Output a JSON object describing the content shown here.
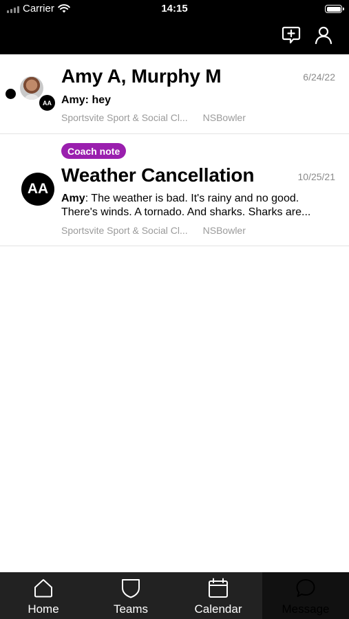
{
  "status_bar": {
    "carrier": "Carrier",
    "time": "14:15"
  },
  "header": {
    "icons": [
      "new-message-icon",
      "profile-icon"
    ]
  },
  "conversations": [
    {
      "title": "Amy A, Murphy M",
      "date": "6/24/22",
      "preview_sender": "Amy:",
      "preview_text": " hey",
      "team": "Sportsvite Sport & Social Cl...",
      "author": "NSBowler",
      "avatar_initials": "AA",
      "unread": true
    },
    {
      "badge": "Coach note",
      "title": "Weather Cancellation",
      "date": "10/25/21",
      "preview_sender": "Amy",
      "preview_text": ": The weather is bad. It's rainy and no good. There's winds. A tornado. And sharks. Sharks are...",
      "team": "Sportsvite Sport & Social Cl...",
      "author": "NSBowler",
      "avatar_initials": "AA"
    }
  ],
  "tabbar": {
    "tabs": [
      {
        "label": "Home",
        "icon": "home-icon"
      },
      {
        "label": "Teams",
        "icon": "shield-icon"
      },
      {
        "label": "Calendar",
        "icon": "calendar-icon"
      },
      {
        "label": "Message",
        "icon": "message-icon",
        "active": true
      }
    ]
  }
}
